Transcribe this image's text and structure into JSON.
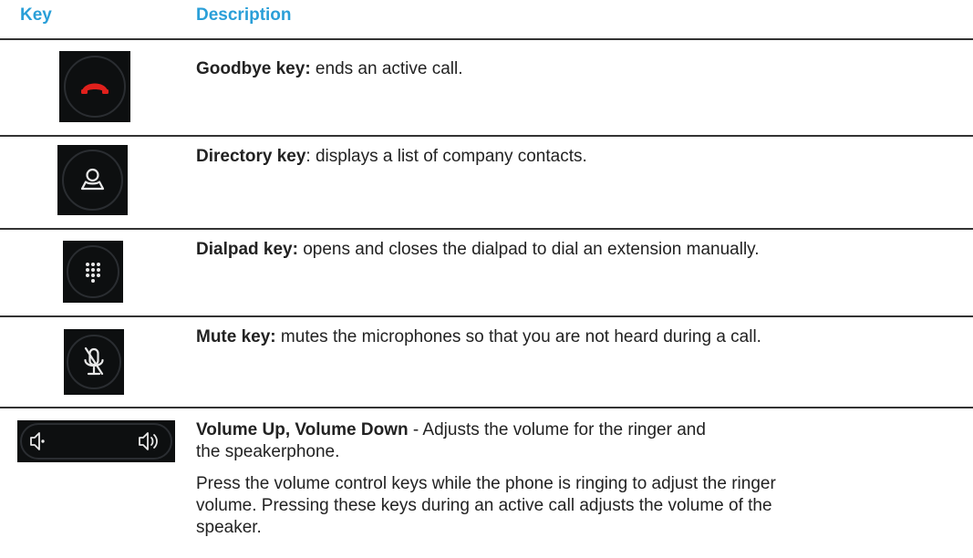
{
  "header": {
    "key_label": "Key",
    "description_label": "Description"
  },
  "rows": [
    {
      "icon": "end-call-icon",
      "title": "Goodbye key:",
      "text": " ends an active call."
    },
    {
      "icon": "contact-person-icon",
      "title": "Directory key",
      "text": ": displays a list of company contacts."
    },
    {
      "icon": "dialpad-icon",
      "title": "Dialpad key:",
      "text": " opens and closes the dialpad to dial an extension manually."
    },
    {
      "icon": "mic-muted-icon",
      "title": "Mute key:",
      "text": " mutes the microphones so that you are not heard during a call."
    },
    {
      "icon": "volume-keys-icon",
      "title": "Volume Up, Volume Down",
      "text": " - Adjusts the volume for the ringer and the speakerphone.",
      "paragraph": "Press the volume control keys while the phone is ringing to adjust the ringer volume. Pressing these keys during an active call adjusts the volume of the speaker."
    }
  ],
  "colors": {
    "header": "#2a9fd8",
    "key_background": "#0d0f10",
    "end_call_red": "#e0201c"
  }
}
